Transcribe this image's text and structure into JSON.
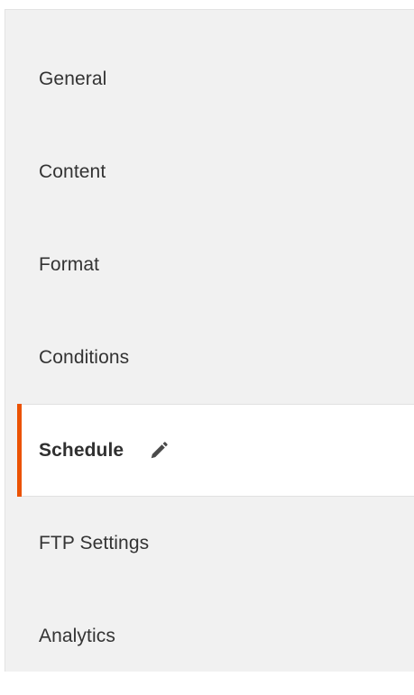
{
  "nav": {
    "items": [
      {
        "label": "General",
        "active": false
      },
      {
        "label": "Content",
        "active": false
      },
      {
        "label": "Format",
        "active": false
      },
      {
        "label": "Conditions",
        "active": false
      },
      {
        "label": "Schedule",
        "active": true,
        "icon": "pencil-icon"
      },
      {
        "label": "FTP Settings",
        "active": false
      },
      {
        "label": "Analytics",
        "active": false
      }
    ]
  },
  "colors": {
    "panel_background": "#f1f1f1",
    "active_background": "#ffffff",
    "active_accent": "#eb5202",
    "text": "#333333"
  }
}
